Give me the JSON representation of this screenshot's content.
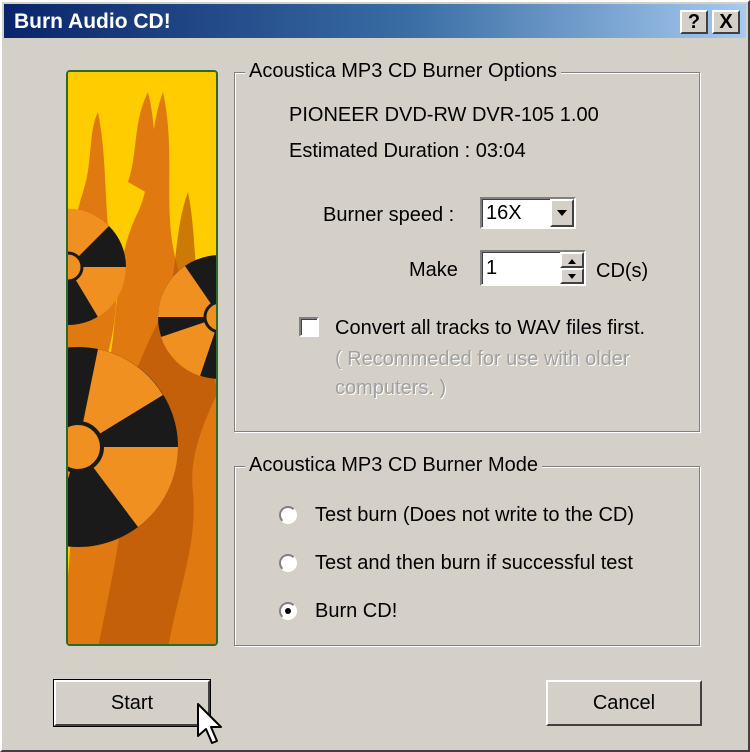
{
  "window": {
    "title": "Burn Audio CD!",
    "help_button": "?",
    "close_button": "X"
  },
  "options_group": {
    "legend": "Acoustica MP3 CD Burner Options",
    "device": "PIONEER DVD-RW  DVR-105 1.00",
    "duration": "Estimated Duration : 03:04",
    "speed_label": "Burner speed :",
    "speed_value": "16X",
    "make_label": "Make",
    "make_value": "1",
    "make_unit": "CD(s)",
    "convert_label": "Convert all tracks to WAV files first.",
    "convert_checked": false,
    "convert_note_line1": "( Recommeded for use with older",
    "convert_note_line2": "computers. )"
  },
  "mode_group": {
    "legend": "Acoustica MP3 CD Burner Mode",
    "options": [
      {
        "label": "Test burn  (Does not write to the CD)",
        "selected": false
      },
      {
        "label": "Test and then burn if successful test",
        "selected": false
      },
      {
        "label": "Burn CD!",
        "selected": true
      }
    ]
  },
  "buttons": {
    "start": "Start",
    "cancel": "Cancel"
  },
  "colors": {
    "title_start": "#0a246a",
    "title_end": "#a6caf0",
    "face": "#d4d0c8",
    "art_bg": "#ffcc00",
    "flame": "#e07a10",
    "flame_dark": "#b85508"
  }
}
